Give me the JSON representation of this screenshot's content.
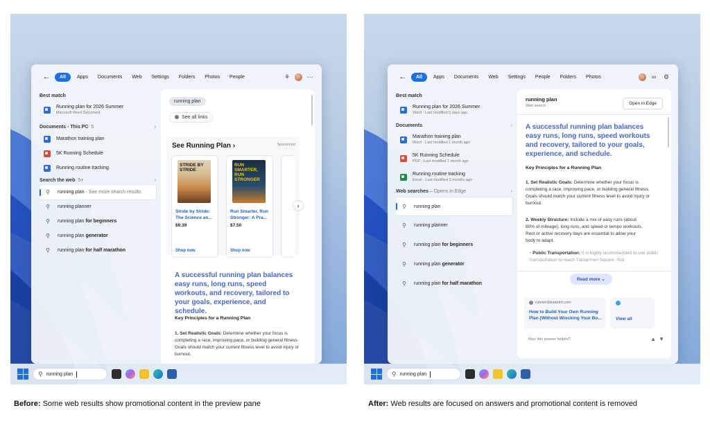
{
  "colors": {
    "accent": "#1f6fe0",
    "answer_blue": "#4667c9",
    "link_blue": "#1f5fb8"
  },
  "before": {
    "filters": [
      "All",
      "Apps",
      "Documents",
      "Web",
      "Settings",
      "Folders",
      "Photos",
      "People"
    ],
    "best_match": {
      "header": "Best match",
      "title": "Running plan for 2026 Summer",
      "subtitle": "Microsoft Word Document"
    },
    "documents": {
      "header": "Documents - This PC",
      "count": "5",
      "items": [
        "Marathon training plan",
        "5K Running Schedule",
        "Running routine tracking"
      ]
    },
    "web": {
      "header": "Search the web",
      "count": "5+",
      "first": "running plan",
      "first_hint": " - See more search results",
      "items": [
        {
          "plain": "running ",
          "bold": "",
          "rest": "planner"
        },
        {
          "plain": "running plan ",
          "bold": "for beginners"
        },
        {
          "plain": "running plan ",
          "bold": "generator"
        },
        {
          "plain": "running plan ",
          "bold": "for half marathon"
        }
      ]
    },
    "preview": {
      "query_chip": "running plan",
      "see_all_links": "See all links",
      "card_title": "See Running Plan",
      "sponsored": "Sponsored",
      "products": [
        {
          "cover": "STRIDE BY STRIDE",
          "title": "Stride by Stride: The Science an...",
          "price": "$9.39",
          "cta": "Shop now"
        },
        {
          "cover": "RUN SMARTER, RUN STRONGER",
          "title": "Run Smarter, Run Stronger: A Pra...",
          "price": "$7.50",
          "cta": "Shop now"
        }
      ],
      "answer": "A successful running plan balances easy runs, long runs, speed workouts, and recovery, tailored to your goals, experience, and schedule.",
      "principles_header": "Key Principles for a Running Plan",
      "p1_label": "1. Set Realistic Goals:",
      "p1_text": " Determine whether your focus is completing a race, improving pace, or building general fitness. Goals should match your current fitness level to avoid injury or burnout."
    },
    "taskbar_query": "running plan"
  },
  "after": {
    "filters": [
      "All",
      "Apps",
      "Documents",
      "Web",
      "Settings",
      "People",
      "Folders",
      "Photos"
    ],
    "best_match": {
      "header": "Best match",
      "title": "Running plan for 2026 Summer",
      "subtitle": "Word · Last modified 5 days ago"
    },
    "documents": {
      "header": "Documents",
      "items": [
        {
          "title": "Marathon training plan",
          "subtitle": "Word · Last modified 1 month ago"
        },
        {
          "title": "5K Running Schedule",
          "subtitle": "PDF · Last modified 1 month ago"
        },
        {
          "title": "Running routine tracking",
          "subtitle": "Excel · Last modified 2 months ago"
        }
      ]
    },
    "web": {
      "header": "Web searches",
      "header_hint": " – Opens in Edge",
      "first": "running plan",
      "items": [
        {
          "plain": "running planner",
          "bold": ""
        },
        {
          "plain": "running plan ",
          "bold": "for beginners"
        },
        {
          "plain": "running plan ",
          "bold": "generator"
        },
        {
          "plain": "running plan ",
          "bold": "for half marathon"
        }
      ]
    },
    "preview": {
      "title": "running plan",
      "subtitle": "Web search",
      "open_button": "Open in Edge",
      "answer": "A successful running plan balances easy runs, long runs, speed workouts and recovery, tailored to your goals, experience, and schedule.",
      "principles_header": "Key Principles for a Running Plan",
      "p1_label": "1. Set Realistic Goals:",
      "p1_text": " Determine whether your focus is completing a race, improving pace, or building general fitness. Goals should match your current fitness level to avoid injury or burnout.",
      "p2_label": "2. Weekly Structure:",
      "p2_text": " Include a mix of easy runs (about 80% of mileage), long runs, and speed or tempo workouts. Rest or active recovery days are essential to allow your body to adapt.",
      "p3_label": "Public Transportation:",
      "p3_text": " It is highly recommended to use public transportation to reach Tiananmen Square. You",
      "read_more": "Read more",
      "source_site": "runnersblueprint.com",
      "source_title": "How to Build Your Own Running Plan (Without Wrecking Your Bo...",
      "view_all": "View all",
      "helpful": "Was this answer helpful?"
    },
    "taskbar_query": "running plan"
  },
  "captions": {
    "before_label": "Before:",
    "before_text": " Some web results show promotional content in the preview pane",
    "after_label": "After:",
    "after_text": " Web results are focused on answers and promotional content is removed"
  }
}
